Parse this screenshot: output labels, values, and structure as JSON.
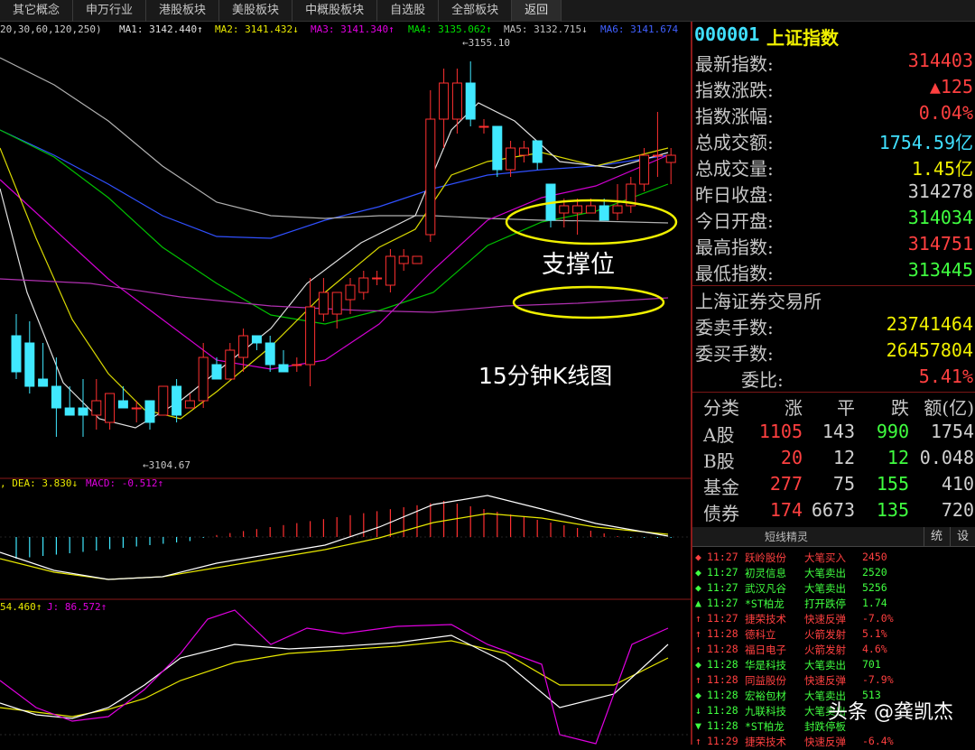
{
  "tabs": [
    "其它概念",
    "申万行业",
    "港股板块",
    "美股板块",
    "中概股板块",
    "自选股",
    "全部板块",
    "返回"
  ],
  "chart": {
    "ma_params": "20,30,60,120,250)",
    "ma_labels": [
      {
        "text": "MA1: 3142.440↑",
        "color": "#e0e0e0"
      },
      {
        "text": "MA2: 3141.432↓",
        "color": "#e8e800"
      },
      {
        "text": "MA3: 3141.340↑",
        "color": "#e000e0"
      },
      {
        "text": "MA4: 3135.062↑",
        "color": "#00e000"
      },
      {
        "text": "MA5: 3132.715↓",
        "color": "#c0c0c0"
      },
      {
        "text": "MA6: 3141.674",
        "color": "#4060ff"
      }
    ],
    "high_label": "3155.10",
    "low_label": "3104.67",
    "annotation_support": "支撑位",
    "annotation_title": "15分钟K线图",
    "macd_labels": [
      {
        "text": ", DEA: 3.830↓",
        "color": "#e8e800"
      },
      {
        "text": "MACD: -0.512↑",
        "color": "#e000e0"
      }
    ],
    "kdj_labels": [
      {
        "text": "54.460↑",
        "color": "#e8e800"
      },
      {
        "text": "J: 86.572↑",
        "color": "#e000e0"
      }
    ],
    "candles": [
      {
        "o": 3117,
        "h": 3120,
        "l": 3111,
        "c": 3112
      },
      {
        "o": 3116,
        "h": 3119,
        "l": 3109,
        "c": 3110
      },
      {
        "o": 3111,
        "h": 3116,
        "l": 3110,
        "c": 3110
      },
      {
        "o": 3110,
        "h": 3114,
        "l": 3103,
        "c": 3107
      },
      {
        "o": 3107,
        "h": 3110,
        "l": 3106,
        "c": 3106
      },
      {
        "o": 3107,
        "h": 3111,
        "l": 3103,
        "c": 3106
      },
      {
        "o": 3106,
        "h": 3111,
        "l": 3104,
        "c": 3108
      },
      {
        "o": 3105,
        "h": 3109,
        "l": 3104,
        "c": 3109
      },
      {
        "o": 3108,
        "h": 3110,
        "l": 3107,
        "c": 3107
      },
      {
        "o": 3107,
        "h": 3108,
        "l": 3105,
        "c": 3107
      },
      {
        "o": 3108,
        "h": 3108,
        "l": 3104,
        "c": 3105
      },
      {
        "o": 3106,
        "h": 3110,
        "l": 3106,
        "c": 3110
      },
      {
        "o": 3110,
        "h": 3111,
        "l": 3105,
        "c": 3106
      },
      {
        "o": 3107,
        "h": 3109,
        "l": 3107,
        "c": 3108
      },
      {
        "o": 3108,
        "h": 3116,
        "l": 3107,
        "c": 3114
      },
      {
        "o": 3113,
        "h": 3114,
        "l": 3111,
        "c": 3111
      },
      {
        "o": 3111,
        "h": 3116,
        "l": 3111,
        "c": 3115
      },
      {
        "o": 3114,
        "h": 3118,
        "l": 3112,
        "c": 3117
      },
      {
        "o": 3117,
        "h": 3117,
        "l": 3115,
        "c": 3116
      },
      {
        "o": 3116,
        "h": 3117,
        "l": 3112,
        "c": 3113
      },
      {
        "o": 3113,
        "h": 3115,
        "l": 3112,
        "c": 3112
      },
      {
        "o": 3113,
        "h": 3114,
        "l": 3112,
        "c": 3113
      },
      {
        "o": 3113,
        "h": 3125,
        "l": 3110,
        "c": 3121
      },
      {
        "o": 3120,
        "h": 3125,
        "l": 3119,
        "c": 3123
      },
      {
        "o": 3120,
        "h": 3123,
        "l": 3118,
        "c": 3123
      },
      {
        "o": 3122,
        "h": 3125,
        "l": 3120,
        "c": 3124
      },
      {
        "o": 3123,
        "h": 3126,
        "l": 3122,
        "c": 3125
      },
      {
        "o": 3125,
        "h": 3126,
        "l": 3124,
        "c": 3125
      },
      {
        "o": 3124,
        "h": 3129,
        "l": 3123,
        "c": 3128
      },
      {
        "o": 3127,
        "h": 3129,
        "l": 3126,
        "c": 3128
      },
      {
        "o": 3127,
        "h": 3128,
        "l": 3127,
        "c": 3128
      },
      {
        "o": 3131,
        "h": 3151,
        "l": 3130,
        "c": 3147
      },
      {
        "o": 3147,
        "h": 3154,
        "l": 3143,
        "c": 3152
      },
      {
        "o": 3147,
        "h": 3154,
        "l": 3145,
        "c": 3152
      },
      {
        "o": 3152,
        "h": 3155,
        "l": 3146,
        "c": 3147
      },
      {
        "o": 3146,
        "h": 3147,
        "l": 3145,
        "c": 3146
      },
      {
        "o": 3146,
        "h": 3146,
        "l": 3139,
        "c": 3140
      },
      {
        "o": 3140,
        "h": 3144,
        "l": 3139,
        "c": 3143
      },
      {
        "o": 3142,
        "h": 3144,
        "l": 3141,
        "c": 3143
      },
      {
        "o": 3144,
        "h": 3144,
        "l": 3140,
        "c": 3141
      },
      {
        "o": 3138,
        "h": 3138,
        "l": 3132,
        "c": 3133
      },
      {
        "o": 3134,
        "h": 3136,
        "l": 3132,
        "c": 3135
      },
      {
        "o": 3134,
        "h": 3136,
        "l": 3131,
        "c": 3135
      },
      {
        "o": 3134,
        "h": 3136,
        "l": 3134,
        "c": 3135
      },
      {
        "o": 3135,
        "h": 3136,
        "l": 3133,
        "c": 3133
      },
      {
        "o": 3134,
        "h": 3138,
        "l": 3133,
        "c": 3135
      },
      {
        "o": 3135,
        "h": 3139,
        "l": 3134,
        "c": 3138
      },
      {
        "o": 3138,
        "h": 3143,
        "l": 3137,
        "c": 3142
      },
      {
        "o": 3142,
        "h": 3148,
        "l": 3139,
        "c": 3142
      },
      {
        "o": 3141,
        "h": 3143,
        "l": 3138,
        "c": 3142
      }
    ]
  },
  "quote": {
    "code": "000001",
    "name": "上证指数",
    "rows": [
      {
        "label": "最新指数:",
        "value": "314403",
        "color": "#ff4040"
      },
      {
        "label": "指数涨跌:",
        "value": "▲125",
        "color": "#ff4040"
      },
      {
        "label": "指数涨幅:",
        "value": "0.04%",
        "color": "#ff4040"
      },
      {
        "label": "总成交额:",
        "value": "1754.59亿",
        "color": "#40e0ff"
      },
      {
        "label": "总成交量:",
        "value": "1.45亿",
        "color": "#f0f000"
      },
      {
        "label": "昨日收盘:",
        "value": "314278",
        "color": "#d0d0d0"
      },
      {
        "label": "今日开盘:",
        "value": "314034",
        "color": "#40ff40"
      },
      {
        "label": "最高指数:",
        "value": "314751",
        "color": "#ff4040"
      },
      {
        "label": "最低指数:",
        "value": "313445",
        "color": "#40ff40"
      }
    ],
    "exchange": "上海证券交易所",
    "rows2": [
      {
        "label": "委卖手数:",
        "value": "23741464",
        "color": "#f0f000"
      },
      {
        "label": "委买手数:",
        "value": "26457804",
        "color": "#f0f000"
      },
      {
        "label": "委比:",
        "value": "5.41%",
        "color": "#ff4040"
      }
    ]
  },
  "table": {
    "headers": [
      "分类",
      "涨",
      "平",
      "跌",
      "额(亿)"
    ],
    "rows": [
      {
        "name": "A股",
        "up": "1105",
        "flat": "143",
        "down": "990",
        "amt": "1754"
      },
      {
        "name": "B股",
        "up": "20",
        "flat": "12",
        "down": "12",
        "amt": "0.048"
      },
      {
        "name": "基金",
        "up": "277",
        "flat": "75",
        "down": "155",
        "amt": "410"
      },
      {
        "name": "债券",
        "up": "174",
        "flat": "6673",
        "down": "135",
        "amt": "720"
      }
    ]
  },
  "spirit": {
    "title": "短线精灵",
    "btn1": "统",
    "btn2": "设",
    "items": [
      {
        "mark": "◆",
        "time": "11:27",
        "stock": "跃岭股份",
        "event": "大笔买入",
        "val": "2450",
        "color": "#ff4040"
      },
      {
        "mark": "◆",
        "time": "11:27",
        "stock": "初灵信息",
        "event": "大笔卖出",
        "val": "2520",
        "color": "#40ff40"
      },
      {
        "mark": "◆",
        "time": "11:27",
        "stock": "武汉凡谷",
        "event": "大笔卖出",
        "val": "5256",
        "color": "#40ff40"
      },
      {
        "mark": "▲",
        "time": "11:27",
        "stock": "*ST柏龙",
        "event": "打开跌停",
        "val": "1.74",
        "color": "#40ff40"
      },
      {
        "mark": "↑",
        "time": "11:27",
        "stock": "捷荣技术",
        "event": "快速反弹",
        "val": "-7.0%",
        "color": "#ff4040"
      },
      {
        "mark": "↑",
        "time": "11:28",
        "stock": "德科立",
        "event": "火箭发射",
        "val": "5.1%",
        "color": "#ff4040"
      },
      {
        "mark": "↑",
        "time": "11:28",
        "stock": "福日电子",
        "event": "火箭发射",
        "val": "4.6%",
        "color": "#ff4040"
      },
      {
        "mark": "◆",
        "time": "11:28",
        "stock": "华是科技",
        "event": "大笔卖出",
        "val": "701",
        "color": "#40ff40"
      },
      {
        "mark": "↑",
        "time": "11:28",
        "stock": "同益股份",
        "event": "快速反弹",
        "val": "-7.9%",
        "color": "#ff4040"
      },
      {
        "mark": "◆",
        "time": "11:28",
        "stock": "宏裕包材",
        "event": "大笔卖出",
        "val": "513",
        "color": "#40ff40"
      },
      {
        "mark": "↓",
        "time": "11:28",
        "stock": "九联科技",
        "event": "大笔卖出",
        "val": "",
        "color": "#40ff40"
      },
      {
        "mark": "▼",
        "time": "11:28",
        "stock": "*ST柏龙",
        "event": "封跌停板",
        "val": "",
        "color": "#40ff40"
      },
      {
        "mark": "↑",
        "time": "11:29",
        "stock": "捷荣技术",
        "event": "快速反弹",
        "val": "-6.4%",
        "color": "#ff4040"
      }
    ]
  },
  "watermark": "头条 @龚凯杰"
}
